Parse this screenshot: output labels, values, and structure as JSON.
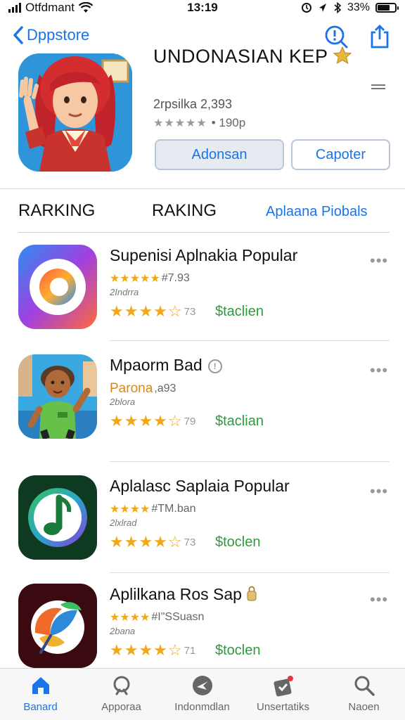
{
  "status_bar": {
    "carrier": "Otfdmant",
    "time": "13:19",
    "battery": "33%"
  },
  "nav": {
    "back_label": "Dppstore"
  },
  "app": {
    "title": "UNDONASIAN KEP",
    "subtitle": "2rpsilka 2,393",
    "rating_stars": "★★★★★",
    "rating_text": "• 190p",
    "primary_button": "Adonsan",
    "secondary_button": "Capoter"
  },
  "tabs": [
    {
      "label": "RARKING"
    },
    {
      "label": "RAKING"
    },
    {
      "label": "Aplaana Piobals"
    }
  ],
  "list": [
    {
      "title": "Supenisi Aplnakia Popular",
      "meta_highlight": "",
      "meta_text": "#7.93",
      "developer": "2Indrra",
      "stars": "★★★★☆",
      "count": "73",
      "price": "$taclien",
      "meta_stars": "★★★★★"
    },
    {
      "title": "Mpaorm Bad",
      "meta_highlight": "Parona",
      "meta_text": ",a93",
      "developer": "2blora",
      "stars": "★★★★☆",
      "count": "79",
      "price": "$taclian",
      "meta_stars": ""
    },
    {
      "title": "Aplalasc Saplaia Popular",
      "meta_highlight": "",
      "meta_text": "#TM.ban",
      "developer": "2lxlrad",
      "stars": "★★★★☆",
      "count": "73",
      "price": "$toclen",
      "meta_stars": "★★★★"
    },
    {
      "title": "Aplilkana Ros Sap",
      "meta_highlight": "",
      "meta_text": "#I\"SSuasn",
      "developer": "2bana",
      "stars": "★★★★☆",
      "count": "71",
      "price": "$toclen",
      "meta_stars": "★★★★"
    }
  ],
  "tab_bar": [
    {
      "label": "Banard",
      "icon": "home-icon"
    },
    {
      "label": "Apporaa",
      "icon": "search-icon"
    },
    {
      "label": "Indonmdlan",
      "icon": "compass-icon"
    },
    {
      "label": "Unsertatiks",
      "icon": "updates-icon"
    },
    {
      "label": "Naoen",
      "icon": "search-icon"
    }
  ],
  "colors": {
    "accent": "#1a73e8",
    "price_green": "#2e9a40",
    "star_gold": "#f0a818"
  }
}
